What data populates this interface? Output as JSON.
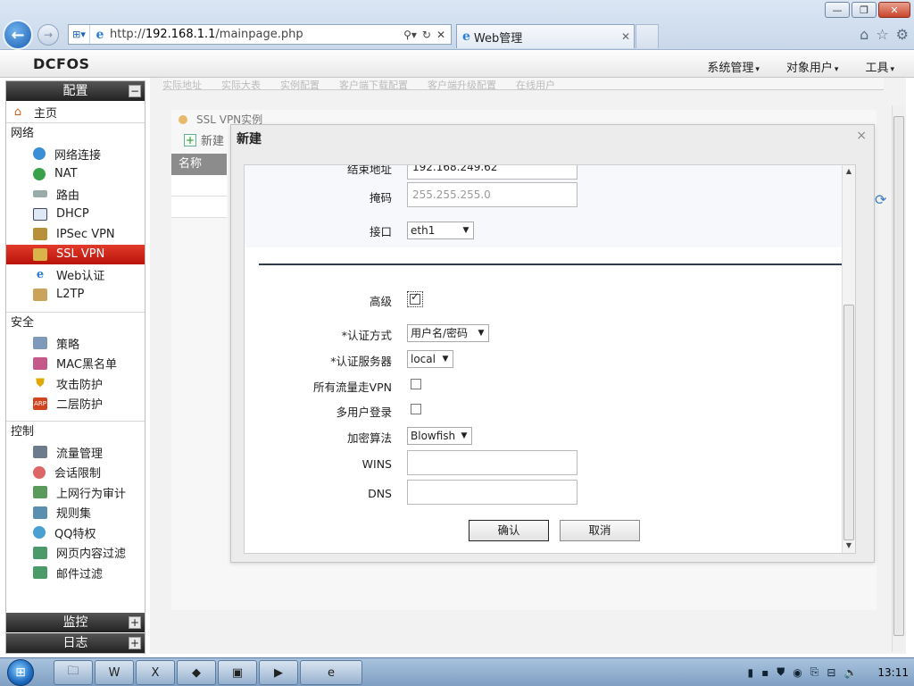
{
  "browser": {
    "url_prefix": "http://",
    "url_host": "192.168.1.1",
    "url_path": "/mainpage.php",
    "tab_title": "Web管理"
  },
  "app": {
    "logo": "DCFOS",
    "menu": [
      "系统管理",
      "对象用户",
      "工具"
    ]
  },
  "sidebar": {
    "header": "配置",
    "header_toggle": "−",
    "home": "主页",
    "sections": [
      {
        "title": "网络",
        "items": [
          "网络连接",
          "NAT",
          "路由",
          "DHCP",
          "IPSec VPN",
          "SSL VPN",
          "Web认证",
          "L2TP"
        ]
      },
      {
        "title": "安全",
        "items": [
          "策略",
          "MAC黑名单",
          "攻击防护",
          "二层防护"
        ]
      },
      {
        "title": "控制",
        "items": [
          "流量管理",
          "会话限制",
          "上网行为审计",
          "规则集",
          "QQ特权",
          "网页内容过滤",
          "邮件过滤"
        ]
      }
    ],
    "active_item": "SSL VPN",
    "bottom": [
      {
        "label": "监控",
        "toggle": "+"
      },
      {
        "label": "日志",
        "toggle": "+"
      }
    ]
  },
  "background_tabs": "实际地址　　实际大表　　实例配置　　客户端下载配置　　客户端升级配置　　在线用户",
  "instance": {
    "title": "SSL VPN实例",
    "new_label": "新建",
    "grid_header": "名称"
  },
  "modal": {
    "title": "新建",
    "close": "×",
    "fields": {
      "end_addr": {
        "label": "结束地址",
        "value": "192.168.249.62"
      },
      "mask": {
        "label": "掩码",
        "placeholder": "255.255.255.0"
      },
      "interface": {
        "label": "接口",
        "value": "eth1"
      },
      "advanced": {
        "label": "高级",
        "checked": true
      },
      "auth_method": {
        "label": "*认证方式",
        "value": "用户名/密码"
      },
      "auth_server": {
        "label": "*认证服务器",
        "value": "local"
      },
      "all_traffic": {
        "label": "所有流量走VPN",
        "checked": false
      },
      "multi_login": {
        "label": "多用户登录",
        "checked": false
      },
      "cipher": {
        "label": "加密算法",
        "value": "Blowfish"
      },
      "wins": {
        "label": "WINS",
        "value": ""
      },
      "dns": {
        "label": "DNS",
        "value": ""
      }
    },
    "confirm": "确认",
    "cancel": "取消"
  },
  "taskbar": {
    "clock": "13:11"
  }
}
